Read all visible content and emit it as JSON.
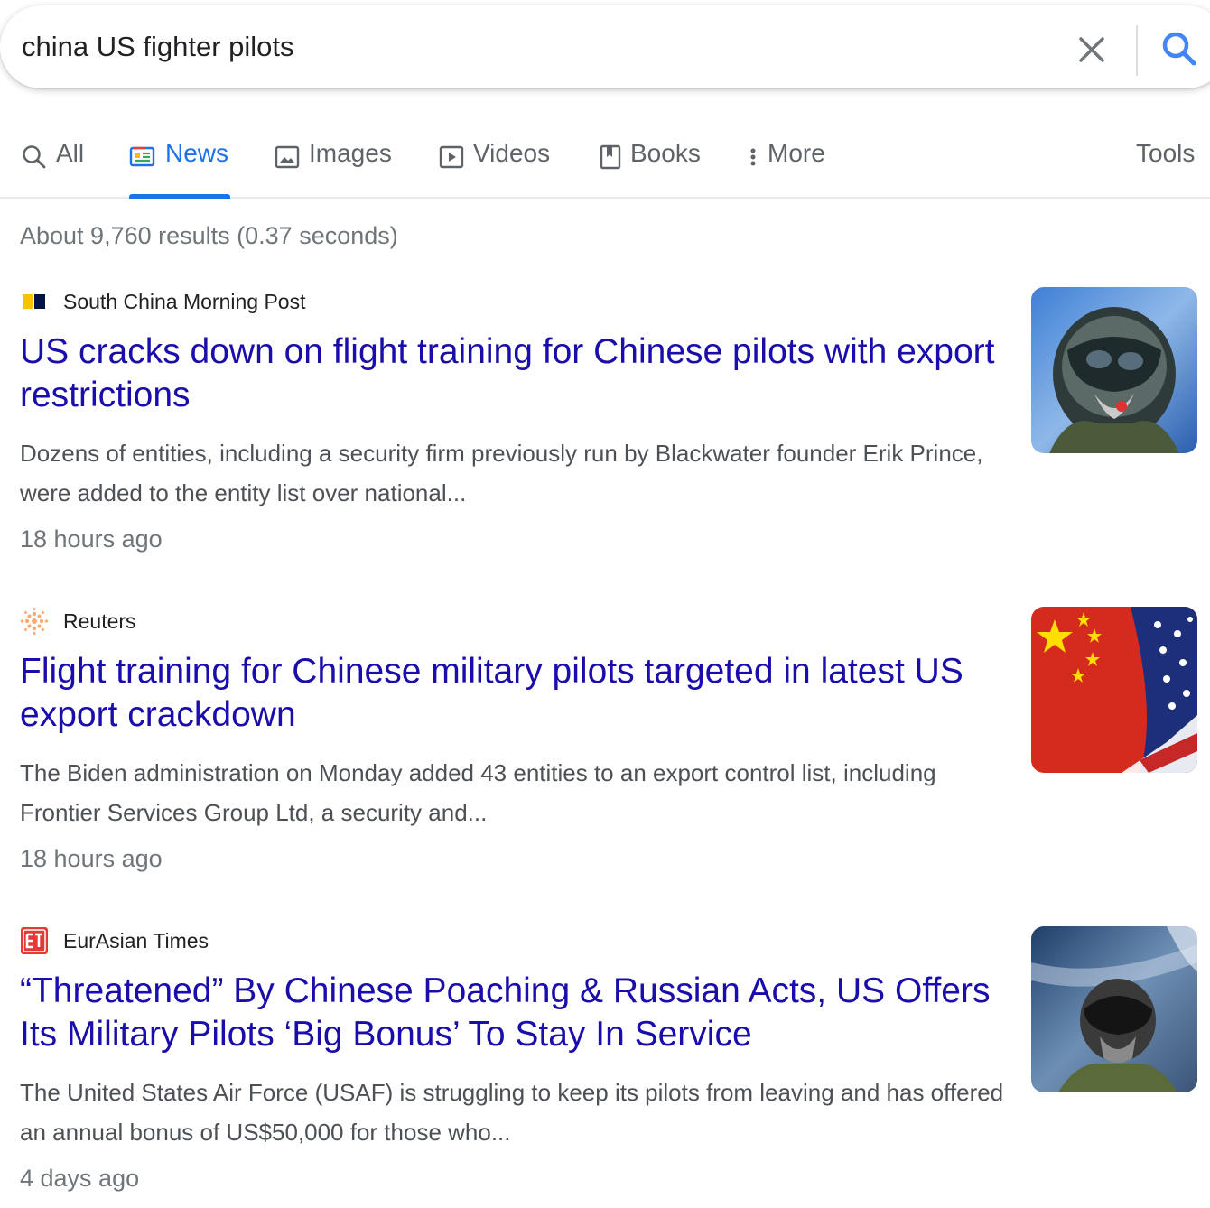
{
  "search": {
    "query": "china US fighter pilots",
    "clear_label": "Clear",
    "search_label": "Search"
  },
  "tabs": [
    {
      "label": "All",
      "icon": "search-icon",
      "active": false
    },
    {
      "label": "News",
      "icon": "news-icon",
      "active": true
    },
    {
      "label": "Images",
      "icon": "image-icon",
      "active": false
    },
    {
      "label": "Videos",
      "icon": "play-icon",
      "active": false
    },
    {
      "label": "Books",
      "icon": "book-icon",
      "active": false
    },
    {
      "label": "More",
      "icon": "more-vertical-icon",
      "active": false
    }
  ],
  "tools_label": "Tools",
  "result_stats": "About 9,760 results (0.37 seconds)",
  "results": [
    {
      "source": "South China Morning Post",
      "favicon": "scmp-logo-icon",
      "title": "US cracks down on flight training for Chinese pilots with export restrictions",
      "snippet": "Dozens of entities, including a security firm previously run by Blackwater founder Erik Prince, were added to the entity list over national...",
      "age": "18 hours ago",
      "thumbnail": "pilot-helmet-photo"
    },
    {
      "source": "Reuters",
      "favicon": "reuters-logo-icon",
      "title": "Flight training for Chinese military pilots targeted in latest US export crackdown",
      "snippet": "The Biden administration on Monday added 43 entities to an export control list, including Frontier Services Group Ltd, a security and...",
      "age": "18 hours ago",
      "thumbnail": "china-us-flags-photo"
    },
    {
      "source": "EurAsian Times",
      "favicon": "eurasian-times-logo-icon",
      "title": "“Threatened” By Chinese Poaching & Russian Acts, US Offers Its Military Pilots ‘Big Bonus’ To Stay In Service",
      "snippet": "The United States Air Force (USAF) is struggling to keep its pilots from leaving and has offered an annual bonus of US$50,000 for those who...",
      "age": "4 days ago",
      "thumbnail": "fighter-pilot-photo"
    }
  ],
  "colors": {
    "link": "#1a0dab",
    "accent": "#1a73e8",
    "muted": "#70757a",
    "snippet": "#4d5156"
  }
}
